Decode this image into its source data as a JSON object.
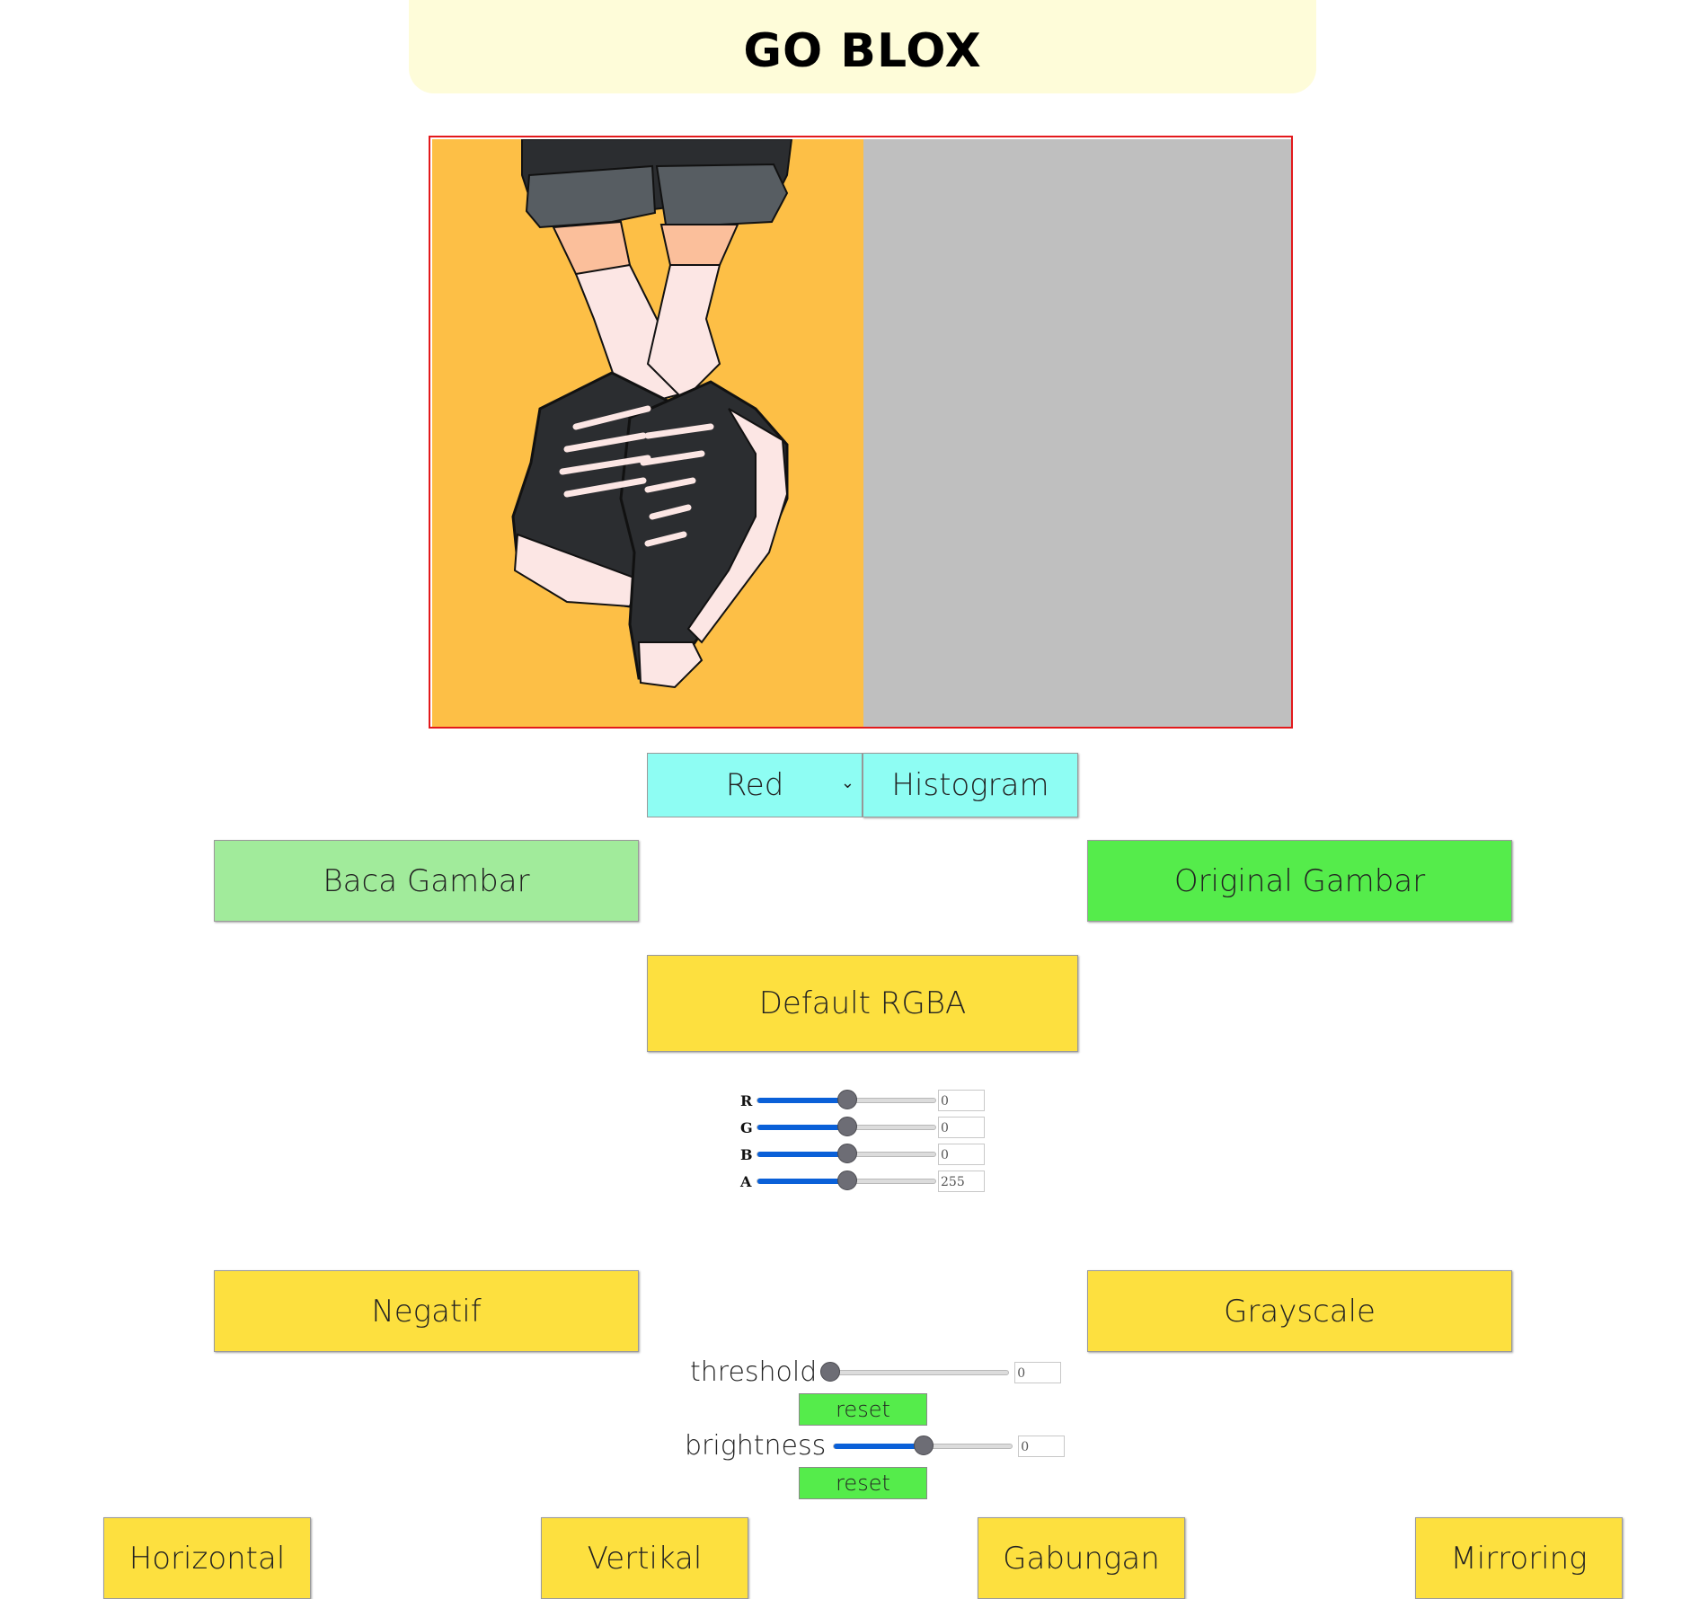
{
  "header": {
    "title": "GO BLOX"
  },
  "canvas": {
    "left_image": "shoes-illustration",
    "right_placeholder": "empty-output",
    "border_color": "#e3191c",
    "left_bg": "#fdbf46",
    "right_bg": "#bfbfbf"
  },
  "channel_select": {
    "selected": "Red"
  },
  "buttons": {
    "histogram": "Histogram",
    "baca_gambar": "Baca Gambar",
    "original_gambar": "Original Gambar",
    "default_rgba": "Default RGBA",
    "negatif": "Negatif",
    "grayscale": "Grayscale",
    "horizontal": "Horizontal",
    "vertikal": "Vertikal",
    "gabungan": "Gabungan",
    "mirroring": "Mirroring"
  },
  "rgba_sliders": [
    {
      "label": "R",
      "value": "0",
      "level": 0.5
    },
    {
      "label": "G",
      "value": "0",
      "level": 0.5
    },
    {
      "label": "B",
      "value": "0",
      "level": 0.5
    },
    {
      "label": "A",
      "value": "255",
      "level": 0.5
    }
  ],
  "threshold": {
    "label": "threshold",
    "value": "0",
    "level": 0.0,
    "reset": "reset"
  },
  "brightness": {
    "label": "brightness",
    "value": "0",
    "level": 0.5,
    "reset": "reset"
  },
  "colors": {
    "yellow": "#fde03f",
    "light_green": "#a1eb9b",
    "green": "#55ec4b",
    "cyan": "#8efdf3",
    "title_bg": "#fefcd9",
    "slider_fill": "#0a60d8"
  }
}
